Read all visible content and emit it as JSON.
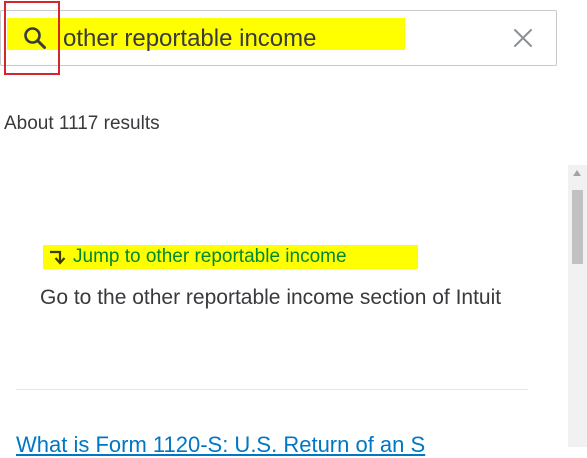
{
  "search": {
    "value": "other reportable income",
    "placeholder": ""
  },
  "results": {
    "count_text": "About 1117 results"
  },
  "jump": {
    "label": "Jump to other reportable income"
  },
  "description": {
    "text": "Go to the other reportable income section of Intuit"
  },
  "next_result": {
    "title": "What is Form 1120-S: U.S. Return of an S"
  },
  "colors": {
    "highlight": "#ffff00",
    "link_green": "#00892e",
    "link_blue": "#0077c5",
    "annotation_red": "#d6262d",
    "text": "#393a3d"
  },
  "icons": {
    "search": "search-icon",
    "clear": "close-icon",
    "jump": "arrow-down-right-icon"
  }
}
